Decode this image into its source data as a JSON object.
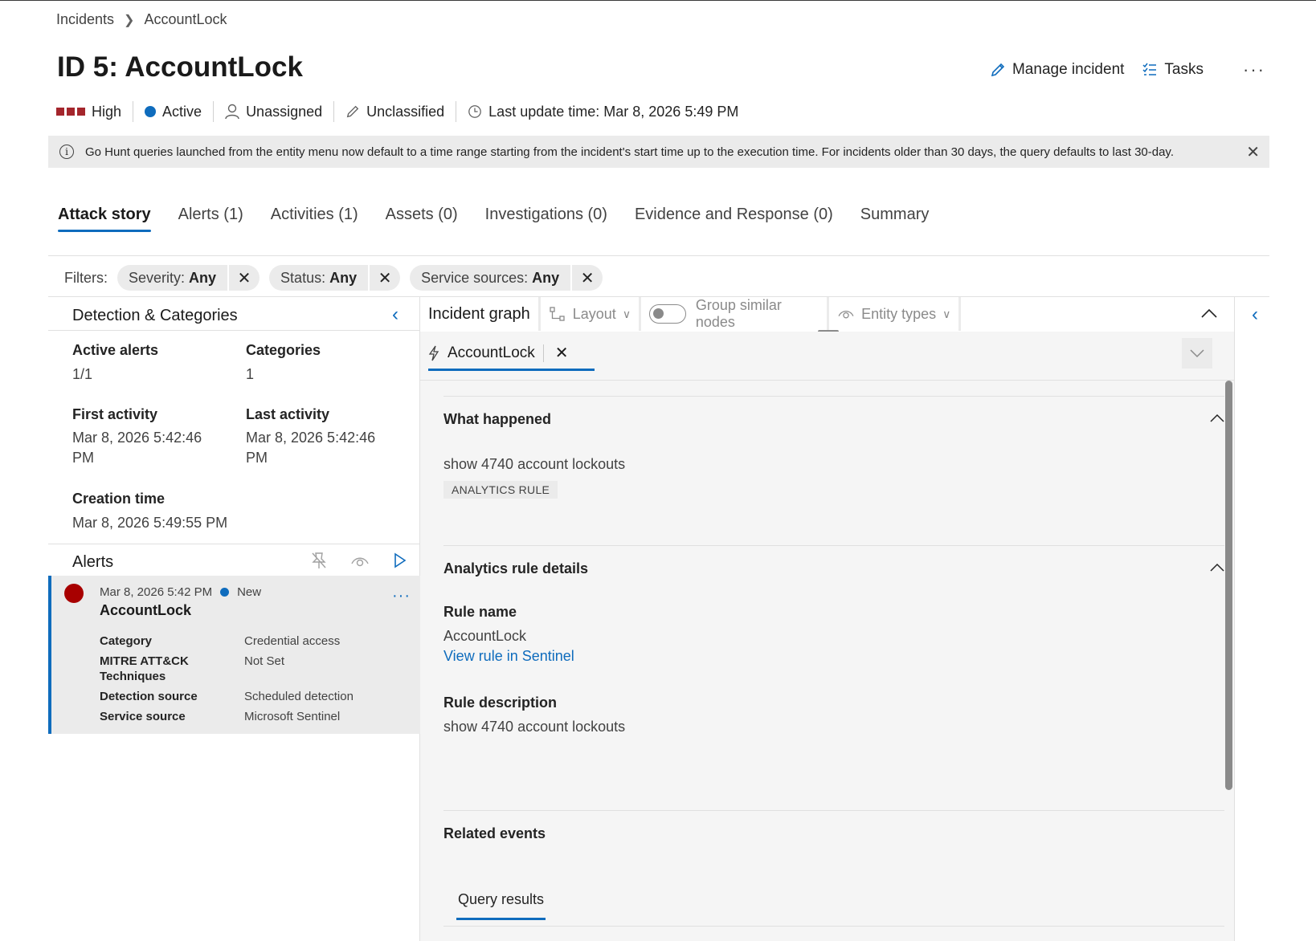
{
  "breadcrumb": {
    "items": [
      "Incidents",
      "AccountLock"
    ]
  },
  "header": {
    "title": "ID 5: AccountLock",
    "manage_incident": "Manage incident",
    "tasks": "Tasks",
    "more": "···"
  },
  "meta": {
    "severity": "High",
    "status": "Active",
    "assignee": "Unassigned",
    "classification": "Unclassified",
    "last_update": "Last update time: Mar 8, 2026 5:49 PM",
    "severity_color": "#a4262c",
    "status_color": "#0f6cbd"
  },
  "banner": {
    "text": "Go Hunt queries launched from the entity menu now default to a time range starting from the incident's start time up to the execution time. For incidents older than 30 days, the query defaults to last 30-day."
  },
  "tabs": [
    {
      "label": "Attack story",
      "active": true
    },
    {
      "label": "Alerts (1)"
    },
    {
      "label": "Activities (1)"
    },
    {
      "label": "Assets (0)"
    },
    {
      "label": "Investigations (0)"
    },
    {
      "label": "Evidence and Response (0)"
    },
    {
      "label": "Summary"
    }
  ],
  "filters": {
    "label": "Filters:",
    "chips": [
      {
        "name": "Severity:",
        "value": "Any"
      },
      {
        "name": "Status:",
        "value": "Any"
      },
      {
        "name": "Service sources:",
        "value": "Any"
      }
    ]
  },
  "detection": {
    "title": "Detection & Categories",
    "active_alerts_label": "Active alerts",
    "active_alerts_value": "1/1",
    "categories_label": "Categories",
    "categories_value": "1",
    "first_activity_label": "First activity",
    "first_activity_value_1": "Mar 8, 2026 5:42:46",
    "first_activity_value_2": "PM",
    "last_activity_label": "Last activity",
    "last_activity_value_1": "Mar 8, 2026 5:42:46",
    "last_activity_value_2": "PM",
    "creation_time_label": "Creation time",
    "creation_time_value": "Mar 8, 2026 5:49:55 PM"
  },
  "alerts": {
    "title": "Alerts",
    "card": {
      "timestamp": "Mar 8, 2026 5:42 PM",
      "status": "New",
      "name": "AccountLock",
      "more": "···",
      "rows": [
        {
          "k": "Category",
          "v": "Credential access"
        },
        {
          "k": "MITRE ATT&CK Techniques",
          "v": "Not Set"
        },
        {
          "k": "Detection source",
          "v": "Scheduled detection"
        },
        {
          "k": "Service source",
          "v": "Microsoft Sentinel"
        }
      ]
    }
  },
  "graph_toolbar": {
    "title": "Incident graph",
    "layout": "Layout",
    "group_similar": "Group similar nodes",
    "entity_types": "Entity types"
  },
  "details": {
    "tab_label": "AccountLock",
    "what_happened_title": "What happened",
    "what_happened_text": "show 4740 account lockouts",
    "rule_badge": "ANALYTICS RULE",
    "rule_details_title": "Analytics rule details",
    "rule_name_label": "Rule name",
    "rule_name_value": "AccountLock",
    "view_rule_link": "View rule in Sentinel",
    "rule_desc_label": "Rule description",
    "rule_desc_value": "show 4740 account lockouts",
    "related_events_title": "Related events",
    "query_results_tab": "Query results"
  }
}
